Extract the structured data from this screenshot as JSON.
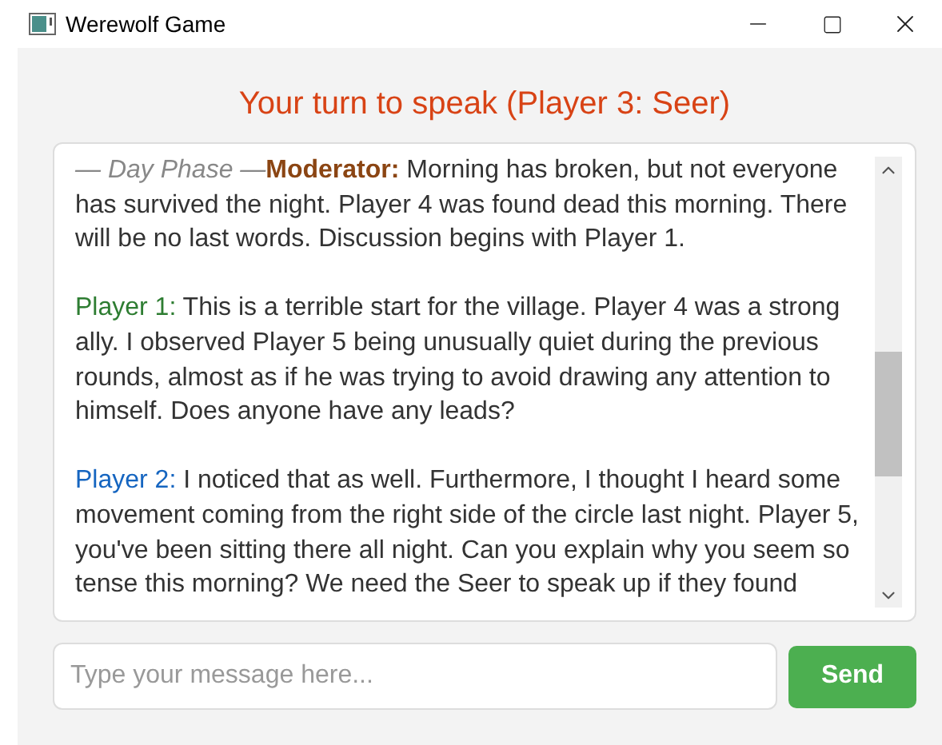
{
  "window": {
    "title": "Werewolf Game"
  },
  "heading": "Your turn to speak (Player 3: Seer)",
  "messages": [
    {
      "phase": "— Day Phase —",
      "speaker": "Moderator:",
      "color": "#8b4513",
      "text": "Morning has broken, but not everyone has survived the night. Player 4 was found dead this morning. There will be no last words. Discussion begins with Player 1."
    },
    {
      "speaker": "Player 1:",
      "color": "#2e7d32",
      "text": "This is a terrible start for the village. Player 4 was a strong ally. I observed Player 5 being unusually quiet during the previous rounds, almost as if he was trying to avoid drawing any attention to himself. Does anyone have any leads?"
    },
    {
      "speaker": "Player 2:",
      "color": "#1565c0",
      "text": "I noticed that as well. Furthermore, I thought I heard some movement coming from the right side of the circle last night. Player 5, you've been sitting there all night. Can you explain why you seem so tense this morning? We need the Seer to speak up if they found"
    }
  ],
  "composer": {
    "placeholder": "Type your message here...",
    "button": "Send"
  }
}
